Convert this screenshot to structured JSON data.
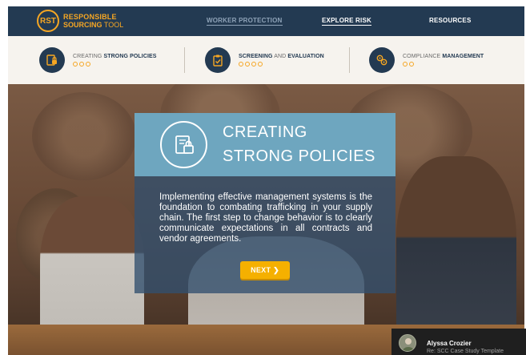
{
  "app": {
    "logo_badge": "RST",
    "logo_line1": "RESPONSIBLE",
    "logo_line2_bold": "SOURCING",
    "logo_line2_rest": " TOOL",
    "brand_color": "#f5a623",
    "header_color": "#233a52"
  },
  "nav": {
    "items": [
      {
        "label": "WORKER PROTECTION",
        "state": "active"
      },
      {
        "label": "EXPLORE RISK",
        "state": "default"
      },
      {
        "label": "RESOURCES",
        "state": "default"
      }
    ]
  },
  "steps": [
    {
      "pre": "CREATING ",
      "bold": "STRONG POLICIES",
      "post": "",
      "icon": "policy-document-icon",
      "dots": 3
    },
    {
      "pre": "",
      "bold": "SCREENING",
      "post": " AND ",
      "bold2": "EVALUATION",
      "icon": "clipboard-check-icon",
      "dots": 4
    },
    {
      "pre": "COMPLIANCE ",
      "bold": "MANAGEMENT",
      "post": "",
      "icon": "gears-icon",
      "dots": 2
    }
  ],
  "hero": {
    "title_line1": "CREATING",
    "title_line2": "STRONG POLICIES",
    "icon": "document-lock-icon",
    "body": "Implementing effective management systems is the foundation to combating trafficking in your supply chain. The first step to change behavior is to clearly communicate expectations in all contracts and vendor agreements.",
    "next_label": "NEXT ❯",
    "card_head_color": "#6ea6bf",
    "button_color": "#f5b000"
  },
  "toast": {
    "name": "Alyssa Crozier",
    "subject": "Re: SCC Case Study Template"
  }
}
